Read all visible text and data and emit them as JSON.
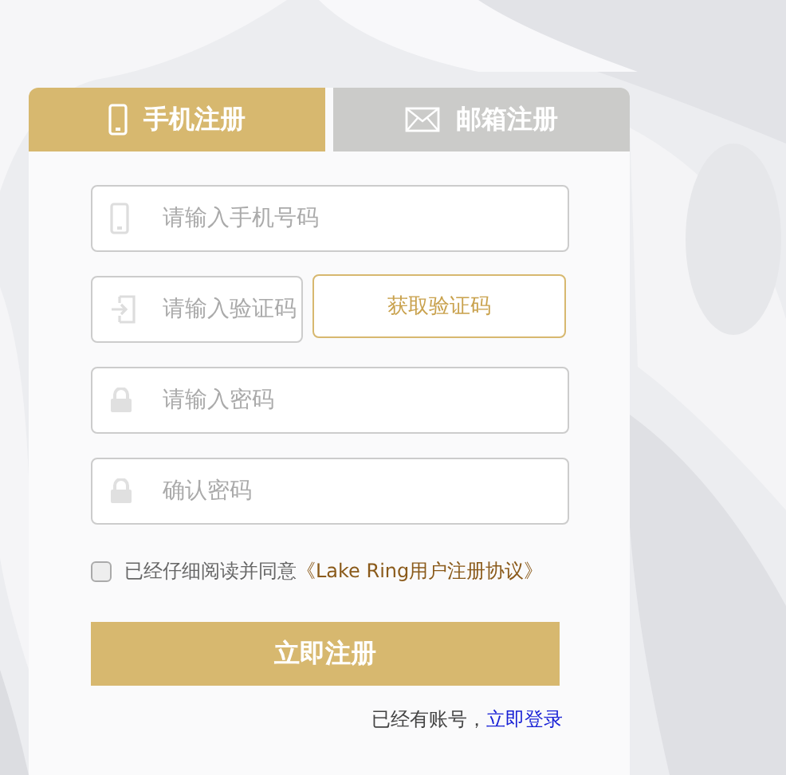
{
  "tabs": [
    {
      "label": "手机注册",
      "kind": "phone",
      "selected": true
    },
    {
      "label": "邮箱注册",
      "kind": "mail",
      "selected": false
    }
  ],
  "fields": [
    {
      "kind": "phone",
      "placeholder": "请输入手机号码"
    },
    {
      "kind": "code",
      "placeholder": "请输入验证码",
      "button": "获取验证码"
    },
    {
      "kind": "password",
      "placeholder": "请输入密码"
    },
    {
      "kind": "password",
      "placeholder": "确认密码"
    }
  ],
  "agreement": {
    "checked": false,
    "text": "已经仔细阅读并同意",
    "link": "《Lake Ring用户注册协议》"
  },
  "submit": "立即注册",
  "login": {
    "text": "已经有账号，",
    "link": "立即登录"
  }
}
